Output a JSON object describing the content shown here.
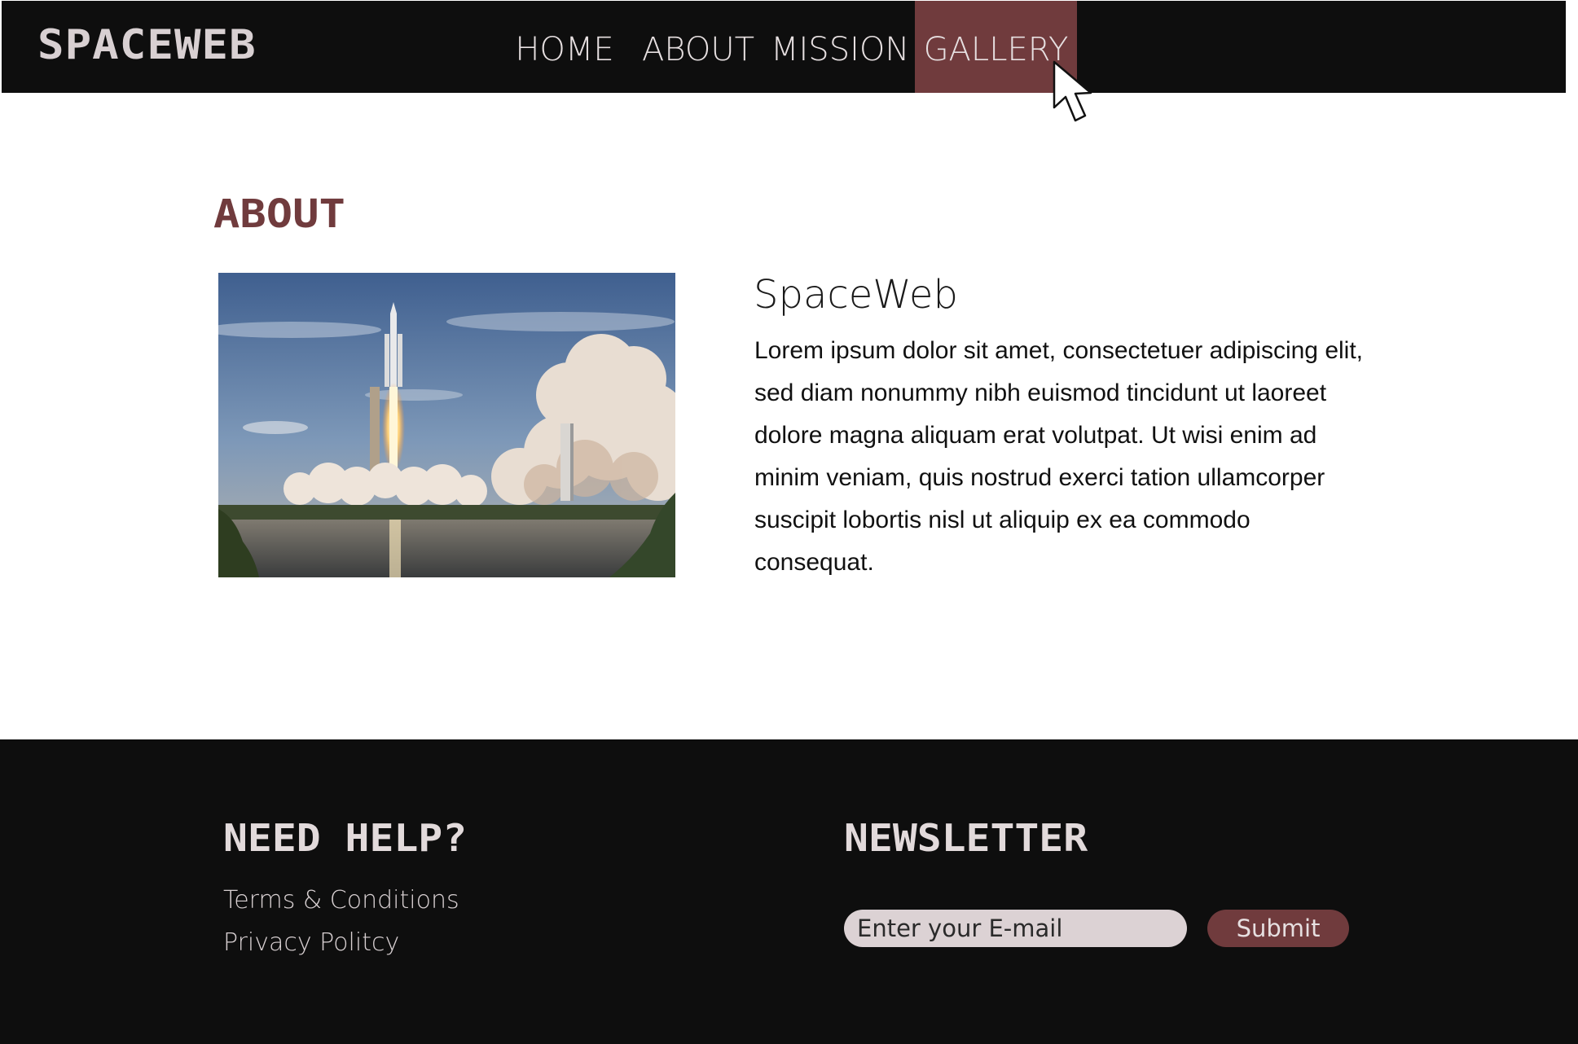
{
  "header": {
    "logo": "SPACEWEB",
    "nav": [
      {
        "label": "HOME",
        "active": false
      },
      {
        "label": "ABOUT",
        "active": false
      },
      {
        "label": "MISSION",
        "active": false
      },
      {
        "label": "GALLERY",
        "active": true
      }
    ]
  },
  "about": {
    "heading": "ABOUT",
    "image_icon": "rocket-launch-photo",
    "title": "SpaceWeb",
    "body": "Lorem ipsum dolor sit amet, consectetuer adipiscing elit, sed diam nonummy nibh euismod tincidunt ut laoreet dolore magna aliquam erat volutpat. Ut wisi enim ad minim veniam, quis nostrud exerci tation ul­lamcorper suscipit lobortis nisl ut aliquip ex ea com­modo consequat."
  },
  "footer": {
    "help_heading": "NEED HELP?",
    "links": [
      "Terms & Conditions",
      "Privacy Politcy"
    ],
    "newsletter_heading": "NEWSLETTER",
    "email_placeholder": "Enter your E-mail",
    "submit_label": "Submit"
  },
  "colors": {
    "bar": "#0e0e0e",
    "accent": "#703b3d",
    "input_bg": "#dcd2d4",
    "light_text": "#e6dfe0"
  }
}
